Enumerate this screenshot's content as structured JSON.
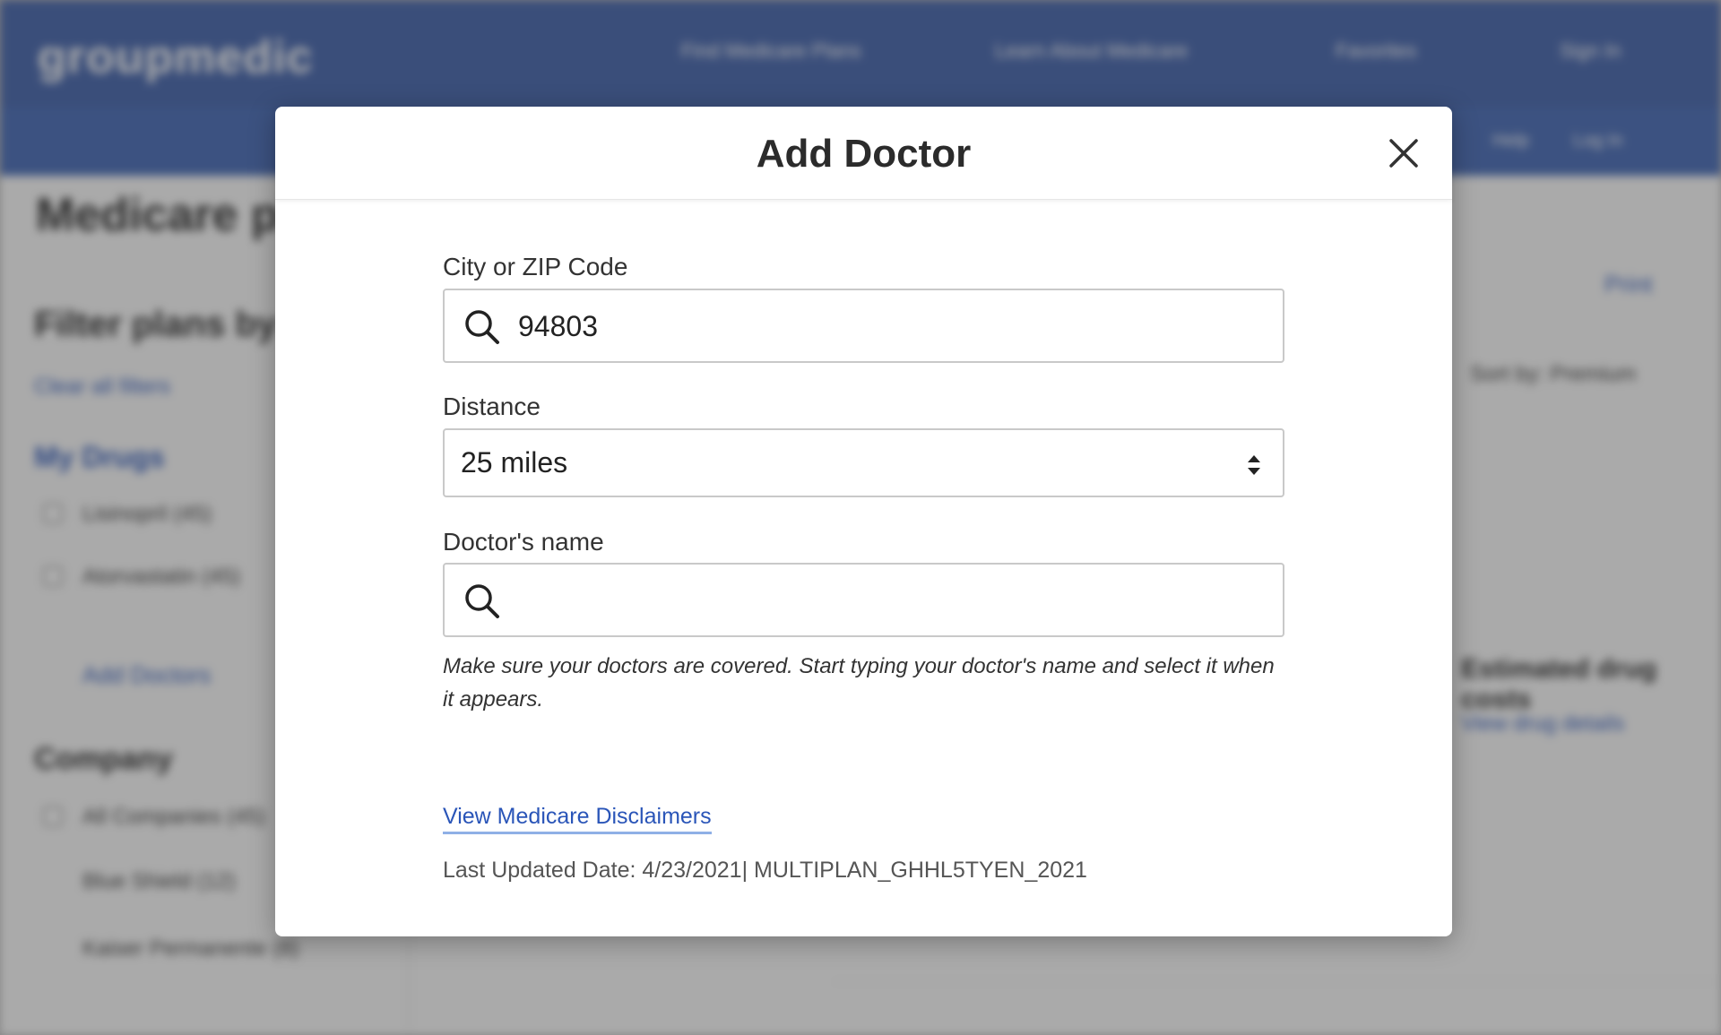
{
  "background": {
    "logo": "groupmedic",
    "nav": [
      "Find Medicare Plans",
      "Learn About Medicare",
      "Favorites",
      "Sign In"
    ],
    "subnav": [
      "Help",
      "Log In"
    ],
    "page_title": "Medicare plans",
    "filter_heading": "Filter plans by",
    "clear_filters": "Clear all filters",
    "my_drugs": "My Drugs",
    "drug_items": [
      "Lisinopril (45)",
      "Atorvastatin (45)"
    ],
    "add_doctor_link": "Add Doctors",
    "company_heading": "Company",
    "company_items": [
      "All Companies (45)",
      "Blue Shield (12)",
      "Kaiser Permanente (8)"
    ],
    "right_link": "Print",
    "sort_label": "Sort by: Premium",
    "right_h": "Estimated drug costs",
    "right_small": "View drug details"
  },
  "modal": {
    "title": "Add Doctor",
    "close_icon": "close-icon",
    "city": {
      "label": "City or ZIP Code",
      "value": "94803",
      "icon": "search-icon"
    },
    "distance": {
      "label": "Distance",
      "value": "25 miles",
      "icon": "select-arrows-icon"
    },
    "doctor": {
      "label": "Doctor's name",
      "value": "",
      "placeholder": "",
      "icon": "search-icon"
    },
    "helper": "Make sure your doctors are covered. Start typing your doctor's name and select it when it appears.",
    "disclaimer_link": "View Medicare Disclaimers",
    "updated": "Last Updated Date: 4/23/2021| MULTIPLAN_GHHL5TYEN_2021"
  }
}
